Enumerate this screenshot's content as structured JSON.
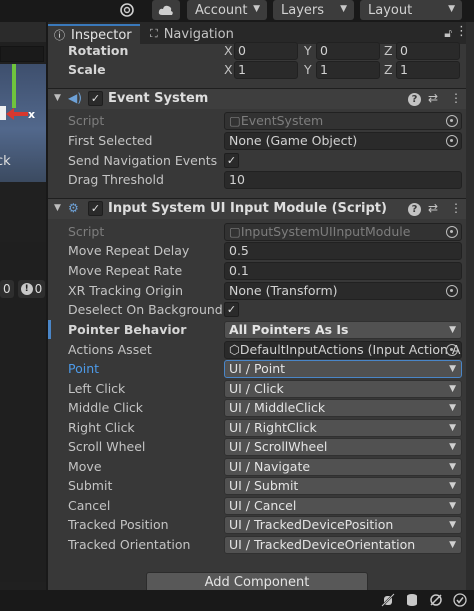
{
  "toolbar": {
    "account_label": "Account",
    "layers_label": "Layers",
    "layout_label": "Layout",
    "icons": [
      "cloud-build-icon",
      "cloud-icon"
    ]
  },
  "left_panel": {
    "scene_label": "ck",
    "scene_axis": "x",
    "count_a": "0",
    "count_b": "0"
  },
  "tabs": [
    {
      "label": "Inspector",
      "icon": "info-icon",
      "active": true
    },
    {
      "label": "Navigation",
      "icon": "navigation-icon",
      "active": false
    }
  ],
  "transform": {
    "rotation": {
      "label": "Rotation",
      "x": "0",
      "y": "0",
      "z": "0"
    },
    "scale": {
      "label": "Scale",
      "x": "1",
      "y": "1",
      "z": "1"
    }
  },
  "event_system": {
    "title": "Event System",
    "enabled": true,
    "fields": {
      "script_label": "Script",
      "script_value": "EventSystem",
      "first_selected_label": "First Selected",
      "first_selected_value": "None (Game Object)",
      "send_nav_label": "Send Navigation Events",
      "send_nav_checked": true,
      "drag_threshold_label": "Drag Threshold",
      "drag_threshold_value": "10"
    }
  },
  "input_module": {
    "title": "Input System UI Input Module (Script)",
    "enabled": true,
    "script_label": "Script",
    "script_value": "InputSystemUIInputModule",
    "move_repeat_delay_label": "Move Repeat Delay",
    "move_repeat_delay_value": "0.5",
    "move_repeat_rate_label": "Move Repeat Rate",
    "move_repeat_rate_value": "0.1",
    "xr_tracking_label": "XR Tracking Origin",
    "xr_tracking_value": "None (Transform)",
    "deselect_label": "Deselect On Background C",
    "deselect_checked": true,
    "pointer_behavior_label": "Pointer Behavior",
    "pointer_behavior_value": "All Pointers As Is",
    "actions_asset_label": "Actions Asset",
    "actions_asset_value": "DefaultInputActions (Input Action As",
    "actions": [
      {
        "label": "Point",
        "value": "UI / Point"
      },
      {
        "label": "Left Click",
        "value": "UI / Click"
      },
      {
        "label": "Middle Click",
        "value": "UI / MiddleClick"
      },
      {
        "label": "Right Click",
        "value": "UI / RightClick"
      },
      {
        "label": "Scroll Wheel",
        "value": "UI / ScrollWheel"
      },
      {
        "label": "Move",
        "value": "UI / Navigate"
      },
      {
        "label": "Submit",
        "value": "UI / Submit"
      },
      {
        "label": "Cancel",
        "value": "UI / Cancel"
      },
      {
        "label": "Tracked Position",
        "value": "UI / TrackedDevicePosition"
      },
      {
        "label": "Tracked Orientation",
        "value": "UI / TrackedDeviceOrientation"
      }
    ]
  },
  "add_component_label": "Add Component",
  "colors": {
    "accent_blue": "#4a86c8",
    "panel_bg": "#383838",
    "dropdown_bg": "#515151"
  }
}
